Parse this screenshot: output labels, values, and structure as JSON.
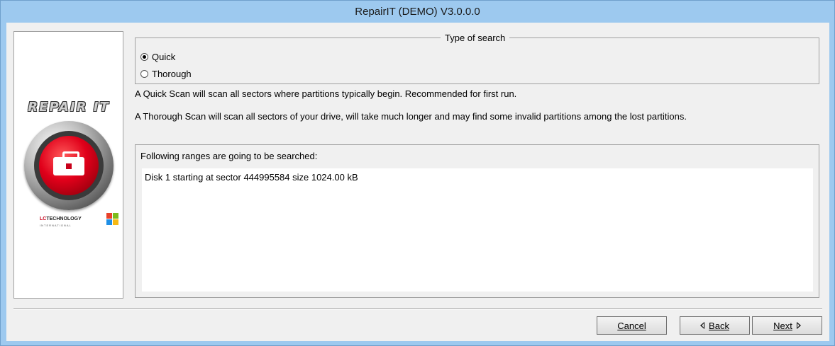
{
  "window": {
    "title": "RepairIT (DEMO) V3.0.0.0"
  },
  "sidebar": {
    "logo_text": "REPAIR IT",
    "brand_name": "LCTECHNOLOGY",
    "brand_prefix": "LC",
    "brand_rest": "TECHNOLOGY",
    "brand_sub": "INTERNATIONAL",
    "logo_icon": "toolbox-icon",
    "os_icon": "windows-flag-icon"
  },
  "search_type": {
    "title": "Type of search",
    "options": [
      {
        "label": "Quick",
        "checked": true
      },
      {
        "label": "Thorough",
        "checked": false
      }
    ]
  },
  "descriptions": {
    "quick": "A Quick Scan will scan all sectors where partitions typically begin. Recommended for first run.",
    "thorough": "A Thorough Scan will scan all sectors of your drive, will take much longer and may find some invalid partitions among the lost partitions."
  },
  "ranges": {
    "label": "Following ranges are going to be searched:",
    "items": [
      "Disk 1 starting at sector 444995584 size 1024.00 kB"
    ]
  },
  "buttons": {
    "cancel": "Cancel",
    "back": "Back",
    "next": "Next"
  },
  "colors": {
    "frame": "#9dc9ef",
    "client": "#f0f0f0",
    "accent_red": "#e0001a"
  }
}
